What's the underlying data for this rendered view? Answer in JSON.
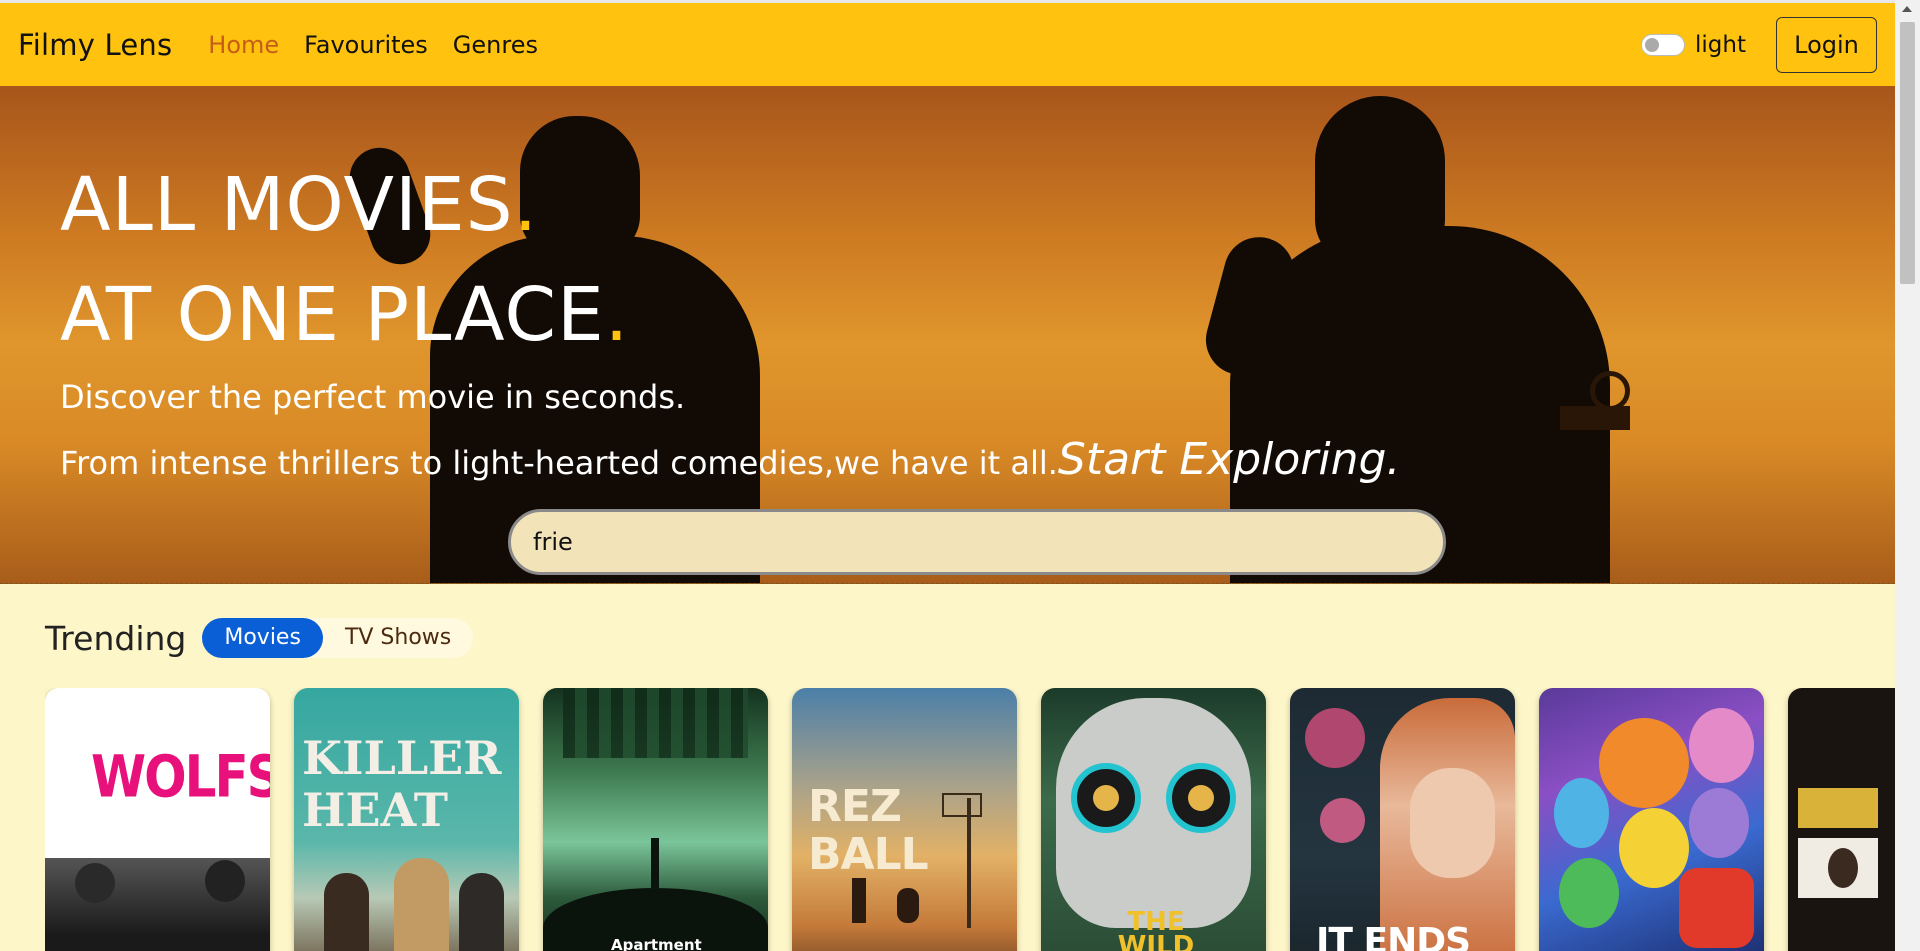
{
  "nav": {
    "brand": "Filmy Lens",
    "links": [
      {
        "label": "Home",
        "active": true
      },
      {
        "label": "Favourites",
        "active": false
      },
      {
        "label": "Genres",
        "active": false
      }
    ],
    "theme_label": "light",
    "login_label": "Login"
  },
  "hero": {
    "line1": "ALL MOVIES",
    "line2": "AT ONE PLACE",
    "dot": ".",
    "sub1": "Discover the perfect movie in seconds.",
    "sub2": "From intense thrillers to light-hearted comedies,we have it all.",
    "sub2_emphasis": "Start Exploring.",
    "search_value": "frie"
  },
  "trending": {
    "title": "Trending",
    "tabs": [
      {
        "label": "Movies",
        "active": true
      },
      {
        "label": "TV Shows",
        "active": false
      }
    ],
    "posters": [
      {
        "title": "WOLFS",
        "color": "#e8107a"
      },
      {
        "title": "KILLER HEAT",
        "color": "#f3efe6"
      },
      {
        "title": "Apartment",
        "color": "#ffffff"
      },
      {
        "title": "REZ BALL",
        "color": "#f6ead0"
      },
      {
        "title": "THE WILD",
        "color": "#f1c12c"
      },
      {
        "title": "IT ENDS",
        "color": "#ffffff"
      },
      {
        "title": "",
        "color": "#ffffff"
      },
      {
        "title": "",
        "color": "#ffffff"
      }
    ]
  },
  "colors": {
    "navbar": "#ffc20e",
    "accent_dot": "#ffc20e",
    "active_link": "#c65d18",
    "active_tab": "#0b5fd6"
  }
}
